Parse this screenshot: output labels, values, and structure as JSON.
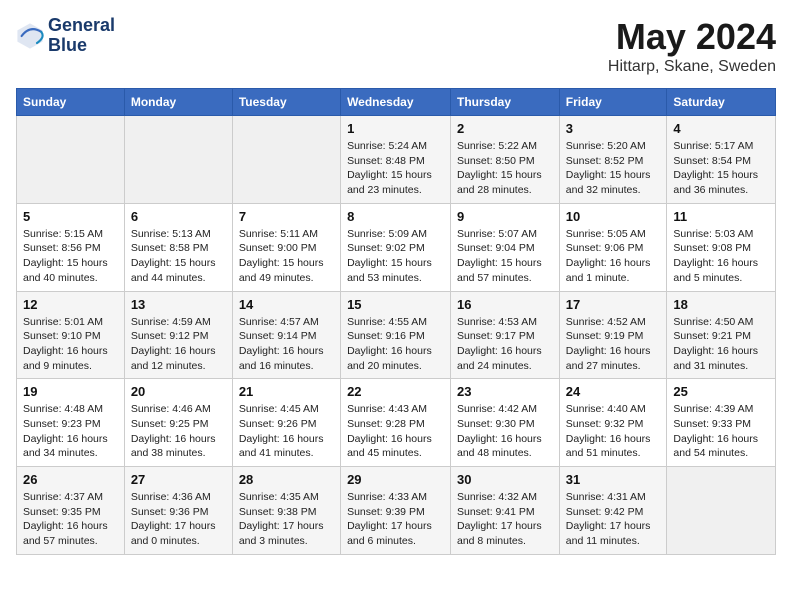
{
  "header": {
    "logo_line1": "General",
    "logo_line2": "Blue",
    "month": "May 2024",
    "location": "Hittarp, Skane, Sweden"
  },
  "weekdays": [
    "Sunday",
    "Monday",
    "Tuesday",
    "Wednesday",
    "Thursday",
    "Friday",
    "Saturday"
  ],
  "weeks": [
    [
      {
        "day": "",
        "info": ""
      },
      {
        "day": "",
        "info": ""
      },
      {
        "day": "",
        "info": ""
      },
      {
        "day": "1",
        "info": "Sunrise: 5:24 AM\nSunset: 8:48 PM\nDaylight: 15 hours\nand 23 minutes."
      },
      {
        "day": "2",
        "info": "Sunrise: 5:22 AM\nSunset: 8:50 PM\nDaylight: 15 hours\nand 28 minutes."
      },
      {
        "day": "3",
        "info": "Sunrise: 5:20 AM\nSunset: 8:52 PM\nDaylight: 15 hours\nand 32 minutes."
      },
      {
        "day": "4",
        "info": "Sunrise: 5:17 AM\nSunset: 8:54 PM\nDaylight: 15 hours\nand 36 minutes."
      }
    ],
    [
      {
        "day": "5",
        "info": "Sunrise: 5:15 AM\nSunset: 8:56 PM\nDaylight: 15 hours\nand 40 minutes."
      },
      {
        "day": "6",
        "info": "Sunrise: 5:13 AM\nSunset: 8:58 PM\nDaylight: 15 hours\nand 44 minutes."
      },
      {
        "day": "7",
        "info": "Sunrise: 5:11 AM\nSunset: 9:00 PM\nDaylight: 15 hours\nand 49 minutes."
      },
      {
        "day": "8",
        "info": "Sunrise: 5:09 AM\nSunset: 9:02 PM\nDaylight: 15 hours\nand 53 minutes."
      },
      {
        "day": "9",
        "info": "Sunrise: 5:07 AM\nSunset: 9:04 PM\nDaylight: 15 hours\nand 57 minutes."
      },
      {
        "day": "10",
        "info": "Sunrise: 5:05 AM\nSunset: 9:06 PM\nDaylight: 16 hours\nand 1 minute."
      },
      {
        "day": "11",
        "info": "Sunrise: 5:03 AM\nSunset: 9:08 PM\nDaylight: 16 hours\nand 5 minutes."
      }
    ],
    [
      {
        "day": "12",
        "info": "Sunrise: 5:01 AM\nSunset: 9:10 PM\nDaylight: 16 hours\nand 9 minutes."
      },
      {
        "day": "13",
        "info": "Sunrise: 4:59 AM\nSunset: 9:12 PM\nDaylight: 16 hours\nand 12 minutes."
      },
      {
        "day": "14",
        "info": "Sunrise: 4:57 AM\nSunset: 9:14 PM\nDaylight: 16 hours\nand 16 minutes."
      },
      {
        "day": "15",
        "info": "Sunrise: 4:55 AM\nSunset: 9:16 PM\nDaylight: 16 hours\nand 20 minutes."
      },
      {
        "day": "16",
        "info": "Sunrise: 4:53 AM\nSunset: 9:17 PM\nDaylight: 16 hours\nand 24 minutes."
      },
      {
        "day": "17",
        "info": "Sunrise: 4:52 AM\nSunset: 9:19 PM\nDaylight: 16 hours\nand 27 minutes."
      },
      {
        "day": "18",
        "info": "Sunrise: 4:50 AM\nSunset: 9:21 PM\nDaylight: 16 hours\nand 31 minutes."
      }
    ],
    [
      {
        "day": "19",
        "info": "Sunrise: 4:48 AM\nSunset: 9:23 PM\nDaylight: 16 hours\nand 34 minutes."
      },
      {
        "day": "20",
        "info": "Sunrise: 4:46 AM\nSunset: 9:25 PM\nDaylight: 16 hours\nand 38 minutes."
      },
      {
        "day": "21",
        "info": "Sunrise: 4:45 AM\nSunset: 9:26 PM\nDaylight: 16 hours\nand 41 minutes."
      },
      {
        "day": "22",
        "info": "Sunrise: 4:43 AM\nSunset: 9:28 PM\nDaylight: 16 hours\nand 45 minutes."
      },
      {
        "day": "23",
        "info": "Sunrise: 4:42 AM\nSunset: 9:30 PM\nDaylight: 16 hours\nand 48 minutes."
      },
      {
        "day": "24",
        "info": "Sunrise: 4:40 AM\nSunset: 9:32 PM\nDaylight: 16 hours\nand 51 minutes."
      },
      {
        "day": "25",
        "info": "Sunrise: 4:39 AM\nSunset: 9:33 PM\nDaylight: 16 hours\nand 54 minutes."
      }
    ],
    [
      {
        "day": "26",
        "info": "Sunrise: 4:37 AM\nSunset: 9:35 PM\nDaylight: 16 hours\nand 57 minutes."
      },
      {
        "day": "27",
        "info": "Sunrise: 4:36 AM\nSunset: 9:36 PM\nDaylight: 17 hours\nand 0 minutes."
      },
      {
        "day": "28",
        "info": "Sunrise: 4:35 AM\nSunset: 9:38 PM\nDaylight: 17 hours\nand 3 minutes."
      },
      {
        "day": "29",
        "info": "Sunrise: 4:33 AM\nSunset: 9:39 PM\nDaylight: 17 hours\nand 6 minutes."
      },
      {
        "day": "30",
        "info": "Sunrise: 4:32 AM\nSunset: 9:41 PM\nDaylight: 17 hours\nand 8 minutes."
      },
      {
        "day": "31",
        "info": "Sunrise: 4:31 AM\nSunset: 9:42 PM\nDaylight: 17 hours\nand 11 minutes."
      },
      {
        "day": "",
        "info": ""
      }
    ]
  ]
}
